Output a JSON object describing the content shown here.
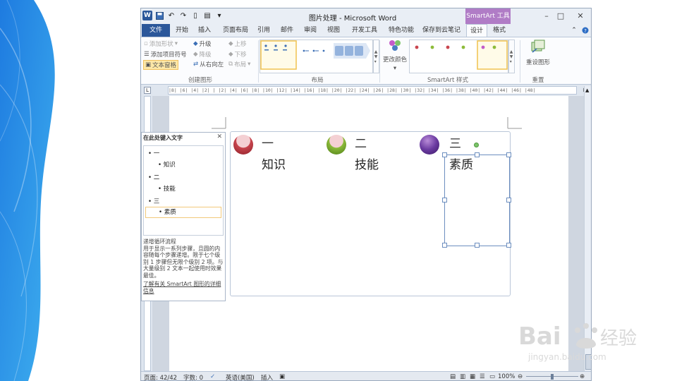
{
  "app": {
    "title": "图片处理 - Microsoft Word",
    "context_tab_head": "SmartArt 工具",
    "window_controls": [
      "–",
      "□",
      "✕"
    ]
  },
  "tabs": [
    {
      "label": "文件",
      "kind": "file"
    },
    {
      "label": "开始"
    },
    {
      "label": "插入"
    },
    {
      "label": "页面布局"
    },
    {
      "label": "引用"
    },
    {
      "label": "邮件"
    },
    {
      "label": "审阅"
    },
    {
      "label": "视图"
    },
    {
      "label": "开发工具"
    },
    {
      "label": "特色功能"
    },
    {
      "label": "保存到云笔记"
    },
    {
      "label": "设计",
      "kind": "active"
    },
    {
      "label": "格式"
    }
  ],
  "ribbon": {
    "create_graphic": {
      "label": "创建图形",
      "add_shape": "添加形状",
      "add_bullet": "添加项目符号",
      "text_pane": "文本窗格",
      "promote": "升级",
      "demote": "降级",
      "right_to_left": "从右向左",
      "move_up": "上移",
      "move_down": "下移",
      "layout": "布局"
    },
    "layouts": {
      "label": "布局"
    },
    "styles": {
      "label": "SmartArt 样式",
      "change_colors": "更改颜色"
    },
    "reset": {
      "label": "重置",
      "reset_graphic": "重设图形"
    }
  },
  "ruler": {
    "marks": "|8| |6| |4| |2| | |2| |4| |6| |8| |10| |12| |14| |16| |18| |20| |22| |24| |26| |28| |30| |32| |34| |36| |38| |40| |42| |44| |46| |48|"
  },
  "text_pane": {
    "title": "在此处键入文字",
    "close": "✕",
    "items": [
      {
        "level": 1,
        "text": "一"
      },
      {
        "level": 2,
        "text": "知识"
      },
      {
        "level": 1,
        "text": "二"
      },
      {
        "level": 2,
        "text": "技能"
      },
      {
        "level": 1,
        "text": "三"
      },
      {
        "level": 2,
        "text": "素质",
        "selected": true
      }
    ],
    "description_title": "递增循环流程",
    "description": "用于显示一系列步骤，且圆的内容随每个步骤递增。限于七个级别 1 步骤但无限个级别 2 项。与大量级别 2 文本一起使用时效果最佳。",
    "link": "了解有关 SmartArt 图形的详细信息"
  },
  "smartart": {
    "steps": [
      {
        "num": "一",
        "text": "知识",
        "color": "#c9464f"
      },
      {
        "num": "二",
        "text": "技能",
        "color": "#8dbb3a"
      },
      {
        "num": "三",
        "text": "素质",
        "color": "#6a3aa0"
      }
    ]
  },
  "status": {
    "page": "页面: 42/42",
    "words": "字数: 0",
    "language": "英语(美国)",
    "mode": "插入",
    "zoom": "100%"
  },
  "watermark": {
    "brand": "Bai",
    "brand_tail": "经验",
    "url": "jingyan.baidu.com"
  },
  "colors": {
    "word_blue": "#2b579a",
    "context_purple": "#b07cc6",
    "slide_accent": "#2e86de"
  }
}
